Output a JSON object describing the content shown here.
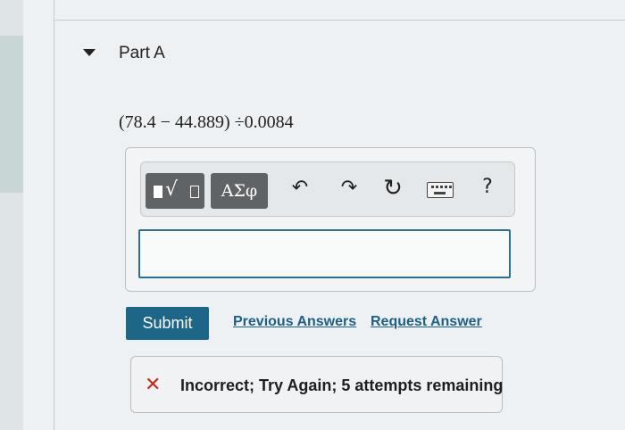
{
  "part": {
    "title": "Part A"
  },
  "problem": {
    "expression": "(78.4 − 44.889) ÷0.0084"
  },
  "toolbar": {
    "templates_icon": "templates-icon",
    "templates_root_glyph": "√",
    "symbols_label": "ΑΣφ",
    "undo_glyph": "↶",
    "redo_glyph": "↷",
    "reset_glyph": "↻",
    "help_label": "?"
  },
  "answer": {
    "value": "",
    "placeholder": ""
  },
  "actions": {
    "submit_label": "Submit",
    "previous_answers_label": "Previous Answers",
    "request_answer_label": "Request Answer"
  },
  "feedback": {
    "icon": "✕",
    "text": "Incorrect; Try Again; 5 attempts remaining",
    "color": "#c8281e"
  },
  "colors": {
    "accent": "#1e6688",
    "link": "#1f5f86",
    "input_border": "#2d6f93"
  }
}
